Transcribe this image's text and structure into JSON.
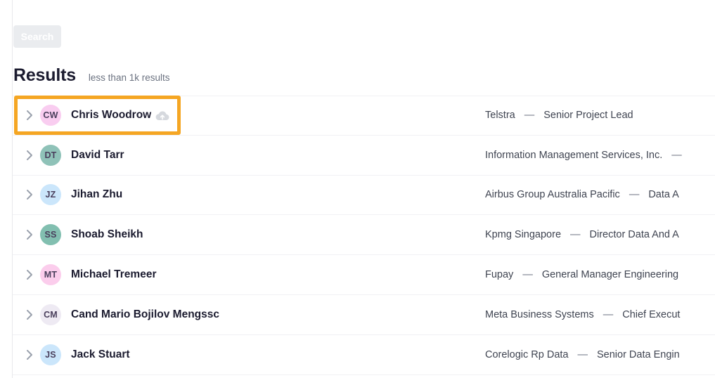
{
  "top_clipped_row": {
    "note_visible_text": "",
    "cells": [
      "",
      "",
      "",
      "",
      "",
      "",
      "",
      "",
      "",
      ""
    ]
  },
  "toolbar": {
    "search_label": "Search"
  },
  "results_header": {
    "title": "Results",
    "count_text": "less than 1k results"
  },
  "icons": {
    "chevron": "chevron-right-icon",
    "cloud": "cloud-upload-icon"
  },
  "colors": {
    "annotation_orange": "#f5a623",
    "name_text": "#1b1b2f",
    "meta_text": "#3f4451",
    "muted_text": "#6b7280",
    "row_divider": "#f1f1f4",
    "search_button_bg": "#eaecef"
  },
  "results": [
    {
      "initials": "CW",
      "avatar_color": "#f9cdf0",
      "name": "Chris Woodrow",
      "has_cloud_icon": true,
      "company": "Telstra",
      "separator": "—",
      "title": "Senior Project Lead",
      "highlighted": true
    },
    {
      "initials": "DT",
      "avatar_color": "#8fc2b8",
      "name": "David Tarr",
      "has_cloud_icon": false,
      "company": "Information Management Services, Inc.",
      "separator": "—",
      "title": "",
      "highlighted": false
    },
    {
      "initials": "JZ",
      "avatar_color": "#cbe6fb",
      "name": "Jihan Zhu",
      "has_cloud_icon": false,
      "company": "Airbus Group Australia Pacific",
      "separator": "—",
      "title": "Data A",
      "highlighted": false
    },
    {
      "initials": "SS",
      "avatar_color": "#82bfb0",
      "name": "Shoab Sheikh",
      "has_cloud_icon": false,
      "company": "Kpmg Singapore",
      "separator": "—",
      "title": "Director Data And A",
      "highlighted": false
    },
    {
      "initials": "MT",
      "avatar_color": "#fbcdec",
      "name": "Michael Tremeer",
      "has_cloud_icon": false,
      "company": "Fupay",
      "separator": "—",
      "title": "General Manager Engineering",
      "highlighted": false
    },
    {
      "initials": "CM",
      "avatar_color": "#eeeaf3",
      "name": "Cand Mario Bojilov Mengssc",
      "has_cloud_icon": false,
      "company": "Meta Business Systems",
      "separator": "—",
      "title": "Chief Execut",
      "highlighted": false
    },
    {
      "initials": "JS",
      "avatar_color": "#cbe6fb",
      "name": "Jack Stuart",
      "has_cloud_icon": false,
      "company": "Corelogic Rp Data",
      "separator": "—",
      "title": "Senior Data Engin",
      "highlighted": false
    }
  ]
}
